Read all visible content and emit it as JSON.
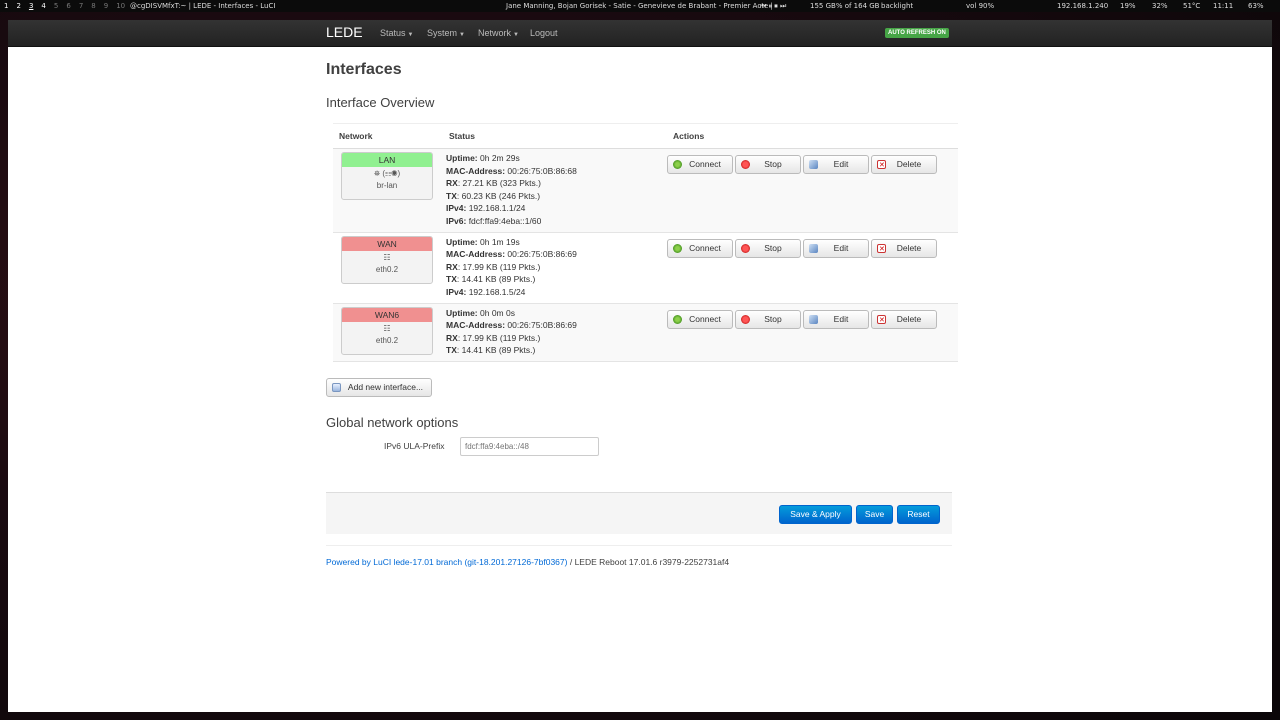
{
  "topbar": {
    "workspaces": [
      "1",
      "2",
      "3",
      "4",
      "5",
      "6",
      "7",
      "8",
      "9",
      "10"
    ],
    "window_title": "@cgDISVMfxT:~ | LEDE - Interfaces - LuCI",
    "media": "Jane Manning, Bojan Gorisek - Satie - Genevieve de Brabant - Premier Acte |",
    "media_controls": "⏮ ⏸ ⏹ ⏭",
    "disk": "155 GB% of 164 GB",
    "backlight": "backlight",
    "volume": "vol 90%",
    "ip": "192.168.1.240",
    "cpu": "19%",
    "mem": "32%",
    "temp": "51°C",
    "clock": "11:11",
    "battery": "63%"
  },
  "nav": {
    "brand": "LEDE",
    "items": [
      "Status",
      "System",
      "Network",
      "Logout"
    ],
    "auto_refresh": "AUTO REFRESH ON"
  },
  "page": {
    "title": "Interfaces",
    "overview_title": "Interface Overview",
    "columns": [
      "Network",
      "Status",
      "Actions"
    ],
    "interfaces": [
      {
        "name": "LAN",
        "icons": "⛯ (☷◉)",
        "device": "br-lan",
        "status": [
          {
            "label": "Uptime:",
            "value": " 0h 2m 29s"
          },
          {
            "label": "MAC-Address:",
            "value": " 00:26:75:0B:86:68"
          },
          {
            "label": "RX",
            "value": ": 27.21 KB (323 Pkts.)"
          },
          {
            "label": "TX",
            "value": ": 60.23 KB (246 Pkts.)"
          },
          {
            "label": "IPv4:",
            "value": " 192.168.1.1/24"
          },
          {
            "label": "IPv6:",
            "value": " fdcf:ffa9:4eba::1/60"
          }
        ]
      },
      {
        "name": "WAN",
        "icons": "☷",
        "device": "eth0.2",
        "status": [
          {
            "label": "Uptime:",
            "value": " 0h 1m 19s"
          },
          {
            "label": "MAC-Address:",
            "value": " 00:26:75:0B:86:69"
          },
          {
            "label": "RX",
            "value": ": 17.99 KB (119 Pkts.)"
          },
          {
            "label": "TX",
            "value": ": 14.41 KB (89 Pkts.)"
          },
          {
            "label": "IPv4:",
            "value": " 192.168.1.5/24"
          }
        ]
      },
      {
        "name": "WAN6",
        "icons": "☷",
        "device": "eth0.2",
        "status": [
          {
            "label": "Uptime:",
            "value": " 0h 0m 0s"
          },
          {
            "label": "MAC-Address:",
            "value": " 00:26:75:0B:86:69"
          },
          {
            "label": "RX",
            "value": ": 17.99 KB (119 Pkts.)"
          },
          {
            "label": "TX",
            "value": ": 14.41 KB (89 Pkts.)"
          }
        ]
      }
    ],
    "action_labels": {
      "connect": "Connect",
      "stop": "Stop",
      "edit": "Edit",
      "delete": "Delete"
    },
    "add_interface": "Add new interface...",
    "global_title": "Global network options",
    "ula_label": "IPv6 ULA-Prefix",
    "ula_value": "fdcf:ffa9:4eba::/48",
    "buttons": {
      "save_apply": "Save & Apply",
      "save": "Save",
      "reset": "Reset"
    },
    "footer_link": "Powered by LuCI lede-17.01 branch (git-18.201.27126-7bf0367)",
    "footer_text": " / LEDE Reboot 17.01.6 r3979-2252731af4"
  },
  "colors": {
    "up": "#90f090",
    "down": "#f09090",
    "primary": "#0064cd",
    "auto_refresh": "#46a546"
  }
}
